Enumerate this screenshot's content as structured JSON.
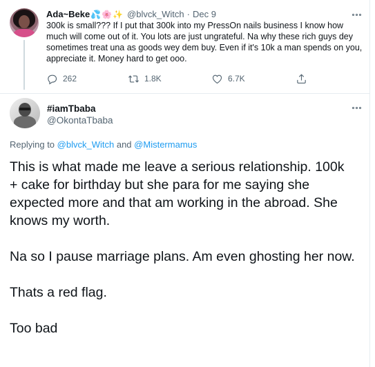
{
  "parent_tweet": {
    "display_name": "Ada~Beke",
    "name_emojis": [
      "💦",
      "🌸",
      "✨"
    ],
    "handle": "@blvck_Witch",
    "separator": "·",
    "date": "Dec 9",
    "text": "300k is small??? If I put that 300k into my PressOn nails business I know how much will come out of it. You lots are just ungrateful. Na why these rich guys dey sometimes treat una as goods wey dem buy. Even if it's 10k a man spends on you, appreciate it. Money hard to get ooo.",
    "actions": {
      "replies": "262",
      "retweets": "1.8K",
      "likes": "6.7K"
    }
  },
  "reply_tweet": {
    "display_name": "#iamTbaba",
    "handle": "@OkontaTbaba",
    "replying_prefix": "Replying to",
    "replying_user1": "@blvck_Witch",
    "replying_and": "and",
    "replying_user2": "@Mistermamus",
    "paragraphs": [
      "This is what made me leave a serious relationship. 100k + cake for birthday but she para for me saying she expected more and that am working in the abroad. She knows my worth.",
      "Na so I pause marriage plans. Am even ghosting her now.",
      "Thats a red flag.",
      "Too bad"
    ]
  },
  "colors": {
    "text": "#0f1419",
    "muted": "#536471",
    "link": "#1d9bf0",
    "divider": "#e6ecf0"
  },
  "icons": [
    "reply-icon",
    "retweet-icon",
    "like-icon",
    "share-icon",
    "more-icon"
  ]
}
